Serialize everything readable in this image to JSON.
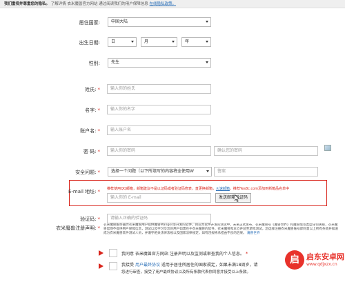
{
  "topbar": {
    "bold": "我们重视并尊重您的隐私。",
    "text": "了解详情 衣米魔兽官方网站 通过阅读我们的用户保障信息",
    "link": "在线隐私政策。"
  },
  "form": {
    "country": {
      "label": "居住国家:",
      "value": "中国大陆"
    },
    "birthdate": {
      "label": "出生日期:",
      "day": "日",
      "month": "月",
      "year": "年"
    },
    "gender": {
      "label": "性别:",
      "value": "先生"
    },
    "surname": {
      "label": "姓氏:",
      "required": "*",
      "placeholder": "输入你的姓氏"
    },
    "firstname": {
      "label": "名字:",
      "required": "*",
      "placeholder": "输入你的名字"
    },
    "account": {
      "label": "账户名:",
      "required": "*",
      "placeholder": "输入账户名"
    },
    "password": {
      "label": "密 码:",
      "required": "*",
      "placeholder": "输入你的密码",
      "confirm_placeholder": "确认您的密码"
    },
    "security": {
      "label": "安全问题:",
      "required": "*",
      "value": "选择一个问题（以下所填写的内容将全使用W",
      "answer_placeholder": "答案"
    },
    "email": {
      "label": "E-mail 地址:",
      "required": "*",
      "warning_prefix": "推荐使用QQ邮箱，邮箱建议不是以证码或者验证码修表，直更换邮箱，",
      "warning_link": "火速邮箱",
      "warning_suffix": "，推荐Yes8c.com添加到新箱品名单中",
      "placeholder": "输入你的 E-mail",
      "send_button": "发送邮箱验证码"
    },
    "verify": {
      "label": "验证码:",
      "required": "*",
      "placeholder": "请输入正确的验证码"
    },
    "terms": {
      "label": "衣米魔兽注册声明:",
      "required": "*",
      "text": "衣米魔兽服务器为衣米魔兽用户提供魔兽Mangos等开发的软件，目前为软件开发的测试中，未来正式发布，衣米魔兽号《魔兽世界》和魔兽端等类型任何关联，衣米魔兽官网不提供用户保障信息，测试以及学习交流的用户如需在于衣米魔兽的软件，衣米魔兽和本仓开前至游戏测试，您选择注册衣米魔兽账号即同意以上所有条款并知道成为衣米魔兽软件测试人员，并遵守相关法律法规以及国家法律规定，如有违规将承担由不良的后果。",
      "link_text": "魔兽世界"
    },
    "agree1": {
      "text": "我同意 衣米魔兽官方网站 注册声明以及监测或审查我的个人信息。",
      "required": "*"
    },
    "agree2": {
      "prefix": "我接受",
      "link": "用户最终协议",
      "suffix": " 适用于居住所居住的国家规定，如果未满18周岁，请",
      "line2": "您进行审查，接受了用户最终协议以及所有条款代表你同意并接受以上条款。"
    }
  },
  "watermark": {
    "mark": "启",
    "title": "启东安卓网",
    "url": "www.qdjxzx.cn"
  }
}
